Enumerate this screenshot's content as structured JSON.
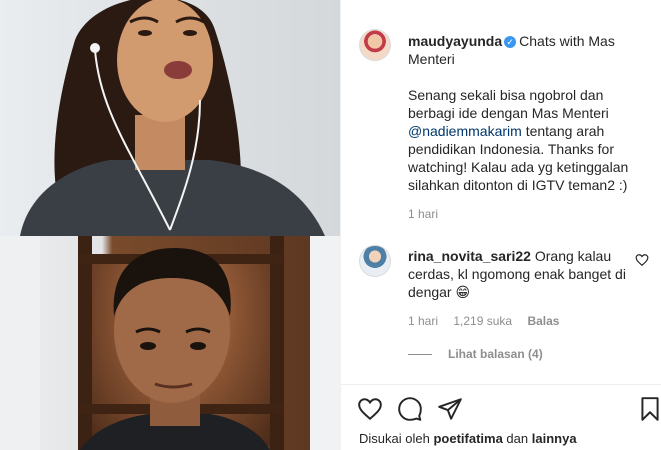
{
  "post": {
    "author": "maudyayunda",
    "title": "Chats with Mas Menteri",
    "caption_part1": "Senang sekali bisa ngobrol dan berbagi ide dengan Mas Menteri",
    "caption_mention": "@nadiemmakarim",
    "caption_part2": "tentang arah pendidikan Indonesia. Thanks for watching! Kalau ada yg ketinggalan silahkan ditonton di IGTV teman2 :)",
    "time": "1 hari",
    "verified_icon": "verified-badge-icon"
  },
  "comment": {
    "author": "rina_novita_sari22",
    "text": "Orang kalau cerdas, kl ngomong enak banget di dengar 😁",
    "time": "1 hari",
    "likes": "1,219 suka",
    "reply_label": "Balas",
    "view_replies": "Lihat balasan (4)"
  },
  "likes_line": {
    "prefix": "Disukai oleh",
    "user": "poetifatima",
    "joiner": "dan",
    "others": "lainnya"
  },
  "icons": {
    "like": "heart-icon",
    "comment": "comment-bubble-icon",
    "share": "paper-plane-icon",
    "save": "bookmark-icon"
  },
  "colors": {
    "text": "#262626",
    "muted": "#8e8e8e",
    "link": "#00376b",
    "verified": "#3897f0"
  }
}
